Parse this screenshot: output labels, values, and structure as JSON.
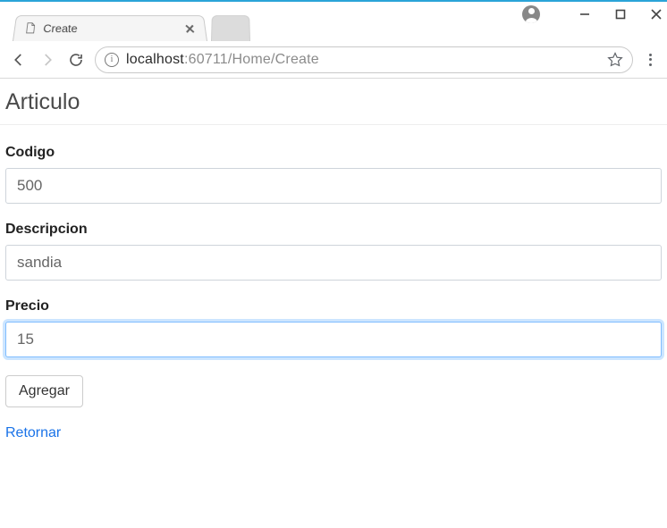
{
  "browser": {
    "tab_title": "Create",
    "url_host": "localhost",
    "url_port_path": ":60711/Home/Create"
  },
  "page": {
    "heading": "Articulo",
    "fields": {
      "codigo": {
        "label": "Codigo",
        "value": "500"
      },
      "descripcion": {
        "label": "Descripcion",
        "value": "sandia"
      },
      "precio": {
        "label": "Precio",
        "value": "15"
      }
    },
    "submit_label": "Agregar",
    "back_link_label": "Retornar"
  }
}
